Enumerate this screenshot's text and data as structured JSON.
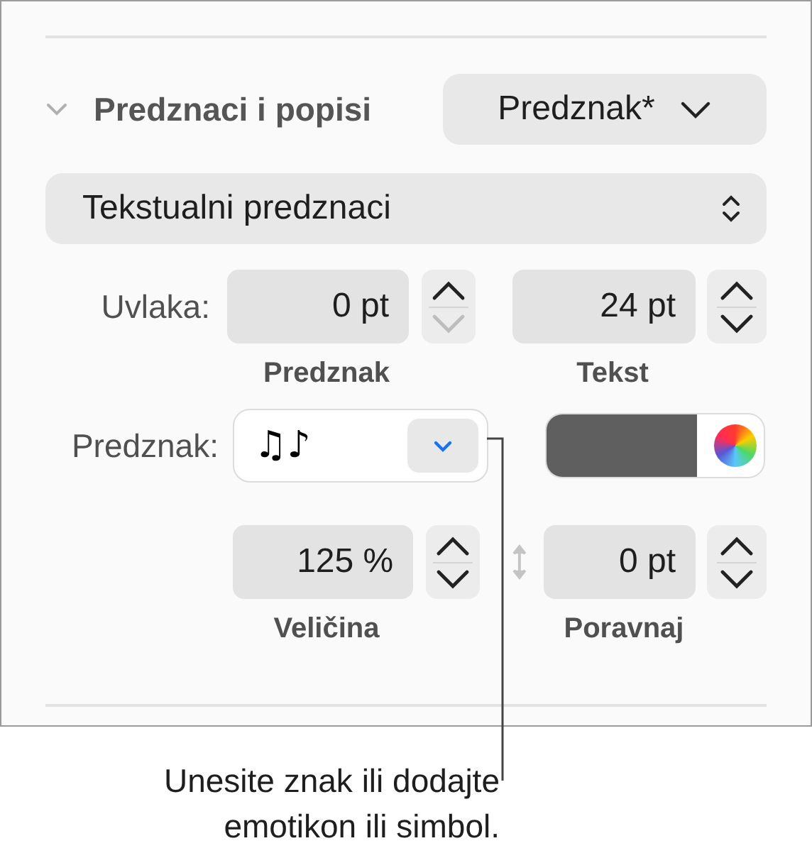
{
  "section": {
    "title": "Predznaci i popisi",
    "expanded": true,
    "style_button": "Predznak*"
  },
  "bullet_type": "Tekstualni predznaci",
  "indent": {
    "label": "Uvlaka:",
    "fields": [
      {
        "value": "0 pt",
        "caption": "Predznak",
        "decrement_disabled": true
      },
      {
        "value": "24 pt",
        "caption": "Tekst",
        "decrement_disabled": false
      }
    ]
  },
  "bullet": {
    "label": "Predznak:",
    "value": "♫♪"
  },
  "size": {
    "value": "125 %",
    "caption": "Veličina",
    "decrement_disabled": false
  },
  "align": {
    "value": "0 pt",
    "caption": "Poravnaj",
    "decrement_disabled": false
  },
  "callout": "Unesite znak ili dodajte\nemotikon ili simbol."
}
